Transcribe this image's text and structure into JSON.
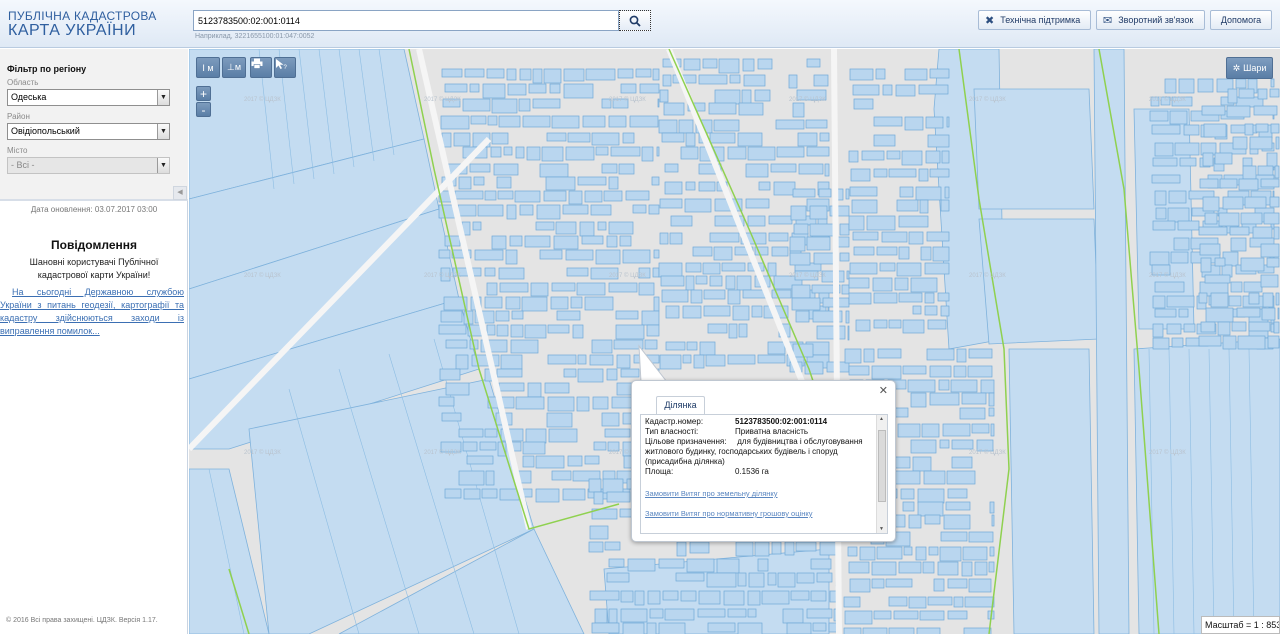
{
  "header": {
    "logo_line1": "ПУБЛІЧНА КАДАСТРОВА",
    "logo_line2": "КАРТА УКРАЇНИ",
    "search_value": "5123783500:02:001:0114",
    "search_hint": "Наприклад, 3221655100:01:047:0052",
    "buttons": {
      "support": "Технічна підтримка",
      "feedback": "Зворотний зв'язок",
      "help": "Допомога"
    }
  },
  "sidebar": {
    "filter_title": "Фільтр по регіону",
    "region_label": "Область",
    "region_value": "Одеська",
    "district_label": "Район",
    "district_value": "Овідіопольський",
    "city_label": "Місто",
    "city_value": "- Всі -",
    "update_date": "Дата оновлення: 03.07.2017 03:00",
    "news_title": "Повідомлення",
    "news_text": "Шановні користувачі Публічної кадастрової карти України!",
    "news_link": "На сьогодні Державною службою України з питань геодезії, картографії та кадастру здійснюються заходи із виправлення помилок...",
    "copyright": "© 2016 Всі права захищені. ЦДЗК. Версія 1.17."
  },
  "map": {
    "tools": {
      "measure_length": "I м",
      "measure_area": "⊥м",
      "print": "print-icon",
      "identify": "identify-icon",
      "zoom_in": "+",
      "zoom_out": "-"
    },
    "layers_label": "Шари",
    "scale": "Масштаб = 1 : 8531",
    "watermark": "2017 © ЦДЗК"
  },
  "popup": {
    "tab": "Ділянка",
    "rows": [
      {
        "key": "Кадастр.номер:",
        "value": "5123783500:02:001:0114"
      },
      {
        "key": "Тип власності:",
        "value": "Приватна власність"
      },
      {
        "key": "Цільове призначення:",
        "value": "для будівництва і обслуговування житлового будинку, господарських будівель і споруд (присадибна ділянка)"
      },
      {
        "key": "Площа:",
        "value": "0.1536 га"
      }
    ],
    "link1": "Замовити Витяг про земельну ділянку",
    "link2": "Замовити Витяг про нормативну грошову оцінку"
  },
  "colors": {
    "parcel_fill": "#b9d6ef",
    "parcel_stroke": "#6fa8d8",
    "boundary": "#8fd14f",
    "map_bg": "#e4e4e4",
    "header_text": "#2f5f9f"
  }
}
